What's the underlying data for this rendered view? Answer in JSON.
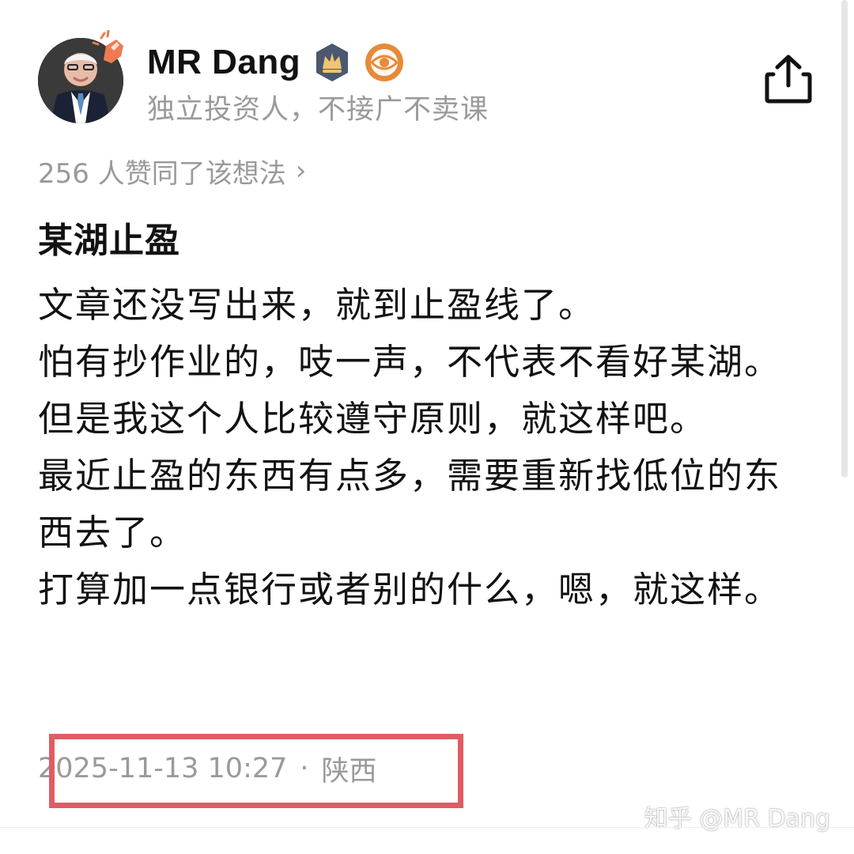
{
  "author": {
    "name": "MR Dang",
    "bio": "独立投资人，不接广不卖课",
    "badges": [
      "crown-badge-icon",
      "eye-badge-icon"
    ]
  },
  "agree": {
    "text": "256 人赞同了该想法",
    "arrow": "›"
  },
  "post": {
    "title": "某湖止盈",
    "lines": [
      "文章还没写出来，就到止盈线了。",
      "怕有抄作业的，吱一声，不代表不看好某湖。",
      "但是我这个人比较遵守原则，就这样吧。",
      "最近止盈的东西有点多，需要重新找低位的东西去了。",
      "打算加一点银行或者别的什么，嗯，就这样。"
    ]
  },
  "meta": {
    "datetime": "2025-11-13 10:27",
    "dot": "·",
    "location": "陕西"
  },
  "watermark": "知乎 @MR Dang",
  "colors": {
    "highlight": "#e05c63",
    "muted_text": "#9a9a9a",
    "badge_crown_bg": "#4b5870",
    "badge_eye_bg": "#e58b3a"
  }
}
